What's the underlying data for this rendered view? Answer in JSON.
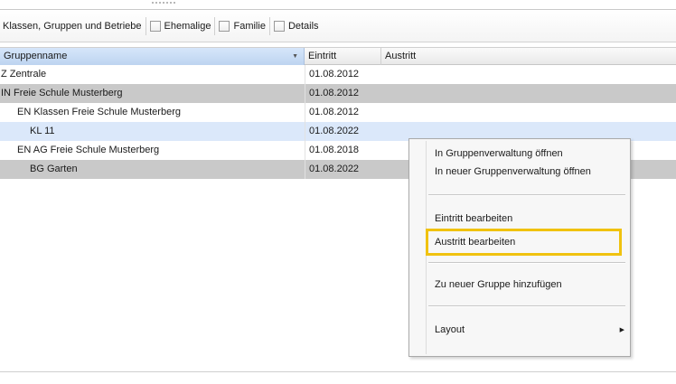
{
  "toolbar": {
    "title": "Klassen, Gruppen und Betriebe",
    "checkboxes": [
      {
        "label": "Ehemalige",
        "checked": false
      },
      {
        "label": "Familie",
        "checked": false
      },
      {
        "label": "Details",
        "checked": false
      }
    ]
  },
  "table": {
    "columns": {
      "name": "Gruppenname",
      "eintritt": "Eintritt",
      "austritt": "Austritt"
    },
    "sort_icon": "sort-descending-icon",
    "rows": [
      {
        "name": "Z Zentrale",
        "eintritt": "01.08.2012",
        "austritt": ""
      },
      {
        "name": "IN Freie Schule Musterberg",
        "eintritt": "01.08.2012",
        "austritt": ""
      },
      {
        "name": "EN Klassen Freie Schule Musterberg",
        "eintritt": "01.08.2012",
        "austritt": ""
      },
      {
        "name": "KL 11",
        "eintritt": "01.08.2022",
        "austritt": ""
      },
      {
        "name": "EN AG Freie Schule Musterberg",
        "eintritt": "01.08.2018",
        "austritt": ""
      },
      {
        "name": "BG Garten",
        "eintritt": "01.08.2022",
        "austritt": ""
      }
    ]
  },
  "context_menu": {
    "items": [
      "In Gruppenverwaltung öffnen",
      "In neuer Gruppenverwaltung öffnen",
      "Eintritt bearbeiten",
      "Austritt bearbeiten",
      "Zu neuer Gruppe hinzufügen",
      "Layout"
    ],
    "highlighted_item": "Austritt bearbeiten",
    "highlight_color": "#f0c20f"
  },
  "colors": {
    "selected_row": "#dbe8fa",
    "gray_row": "#c9c9c9",
    "header_active": "#c8dcf5"
  }
}
